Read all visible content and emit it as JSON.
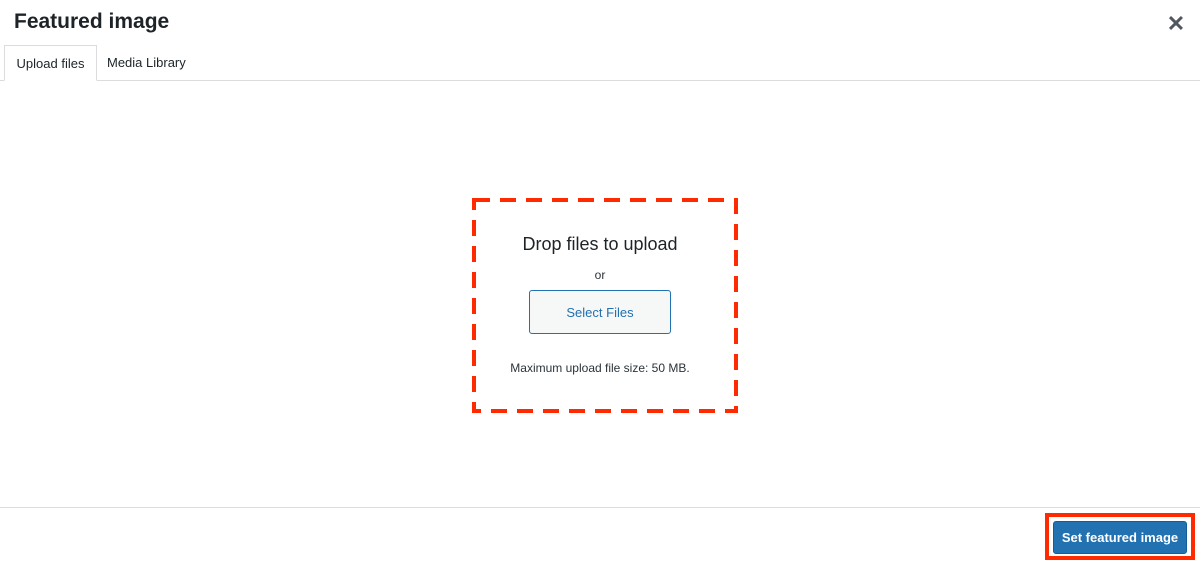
{
  "modal": {
    "title": "Featured image",
    "close_icon": "close-icon",
    "close_glyph": "✕"
  },
  "tabs": [
    {
      "label": "Upload files",
      "active": true
    },
    {
      "label": "Media Library",
      "active": false
    }
  ],
  "uploader": {
    "drop_text": "Drop files to upload",
    "or_text": "or",
    "select_button": "Select Files",
    "max_size_text": "Maximum upload file size: 50 MB.",
    "highlight_color": "#ff2a00"
  },
  "footer": {
    "primary_button": "Set featured image",
    "primary_color": "#2271b1",
    "highlight_color": "#ff2a00"
  }
}
